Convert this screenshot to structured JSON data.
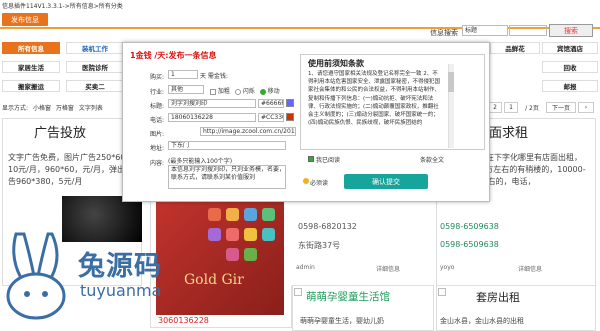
{
  "crumb": "信息插件114V1.3.3.1->所有信息>所有分类",
  "publish_label": "发布信息",
  "search": {
    "label": "信息搜索",
    "select_value": "标题",
    "button": "搜索"
  },
  "categories_row1": [
    "所有信息",
    "装机工作",
    "",
    "",
    "",
    "",
    "品鲜花",
    "宾馆酒店"
  ],
  "categories_row2": [
    "家居生活",
    "医院诊所",
    "",
    "",
    "",
    "",
    "",
    "回收"
  ],
  "categories_row3": [
    "搬家搬运",
    "买卖二",
    "",
    "",
    "",
    "",
    "",
    "邮报"
  ],
  "display": {
    "label": "显示方式:",
    "opt1": "小格窗",
    "opt2": "万格窗",
    "opt3": "文字列表"
  },
  "pagination": {
    "current": "1",
    "p2": "2",
    "p1": "1",
    "total": "/ 2页",
    "next": "下一页"
  },
  "modal": {
    "title": "1金钱 /天:发布一条信息",
    "fields": {
      "pay_label": "购买:",
      "pay_value": "1",
      "pay_unit": "天  需金钱:",
      "industry_label": "行业:",
      "industry_value": "其他",
      "opt_add": "加粗",
      "opt_small": "闪烁",
      "opt_big": "移动",
      "title_label": "标题:",
      "title_value": "刘字刘搜刘印",
      "title_color": "#6666F",
      "phone_label": "电话:",
      "phone_value": "18060136228",
      "phone_color": "#CC330",
      "image_label": "图片:",
      "image_value": "http://image.zcool.com.cn/2013/37/45/c",
      "addr_label": "地址:",
      "addr_value": "下东门",
      "content_hint": "(最多只能输入100个字)",
      "content_label": "内容:",
      "content_value": "本信息刘字刘搜刘印，只刘业务模，名要，联系方式，请联系刘某价值服刘"
    },
    "terms_title": "使用前须知条款",
    "terms_text": "1、请您遵守国家相关法规及登记名称完全一致\n2、不得利用本站危害国家安全、泄露国家秘密，不得侵犯国家社会集体的和公民的合法权益，不得利用本站制作、复制和传播下列信息：(一)煽动抗拒、破坏宪法和法律、行政法规实施的；(二)煽动颠覆国家政权，推翻社会主义制度的；(三)煽动分裂国家、破坏国家统一的；(四)煽动民族仇恨、民族歧视，破坏民族团结的",
    "agree": "我已阅读",
    "agree_link": "条款全文",
    "must_read": "必须读",
    "submit": "确认提交"
  },
  "cards": {
    "ad": {
      "title": "广告投放",
      "text": "文字广告免费，图片广告250*60，10元/月，960*60，元/月，弹出广告960*380，5元/月"
    },
    "store": {
      "title": "店面求租",
      "text": "求租：需在下字化哪里有店面出租，30-40平方左右的有稍楼的，10000-13000左右的，电话，",
      "phone": "0598-6509638"
    },
    "mid_phone1": "0598-6820132",
    "mid_addr": "东街路37号",
    "mid_foot_user": "admin",
    "mid_foot_link": "详细信息",
    "right_phone1": "0598-6509638",
    "right_phone2": "0598-6509638",
    "right_foot_user": "yoyo",
    "right_foot_link": "详细信息",
    "gold": "Gold Gir",
    "phone_caption": "3060136228",
    "nursery": {
      "title": "萌萌孕婴童生活馆",
      "text": "萌萌孕婴童生活，婴幼儿奶"
    },
    "suite": {
      "title": "套房出租",
      "text": "金山水县，金山水县的出租"
    }
  },
  "watermark": {
    "big": "兔源码",
    "small": "tuyuanma"
  }
}
